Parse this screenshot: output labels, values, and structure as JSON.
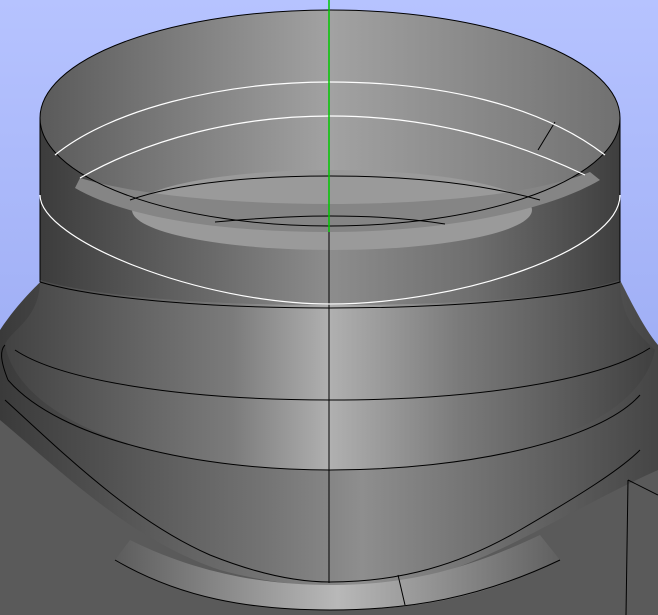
{
  "viewer": {
    "background_top": "#b6c3ff",
    "background_bottom": "#8fa0ee",
    "surface_dark": "#3a3a3a",
    "surface_mid": "#6b6b6b",
    "surface_light": "#b5b5b5",
    "edge_color": "#000000",
    "selected_edge_color": "#ffffff",
    "axis_color": "#00c800",
    "axis_name": "y-axis"
  }
}
